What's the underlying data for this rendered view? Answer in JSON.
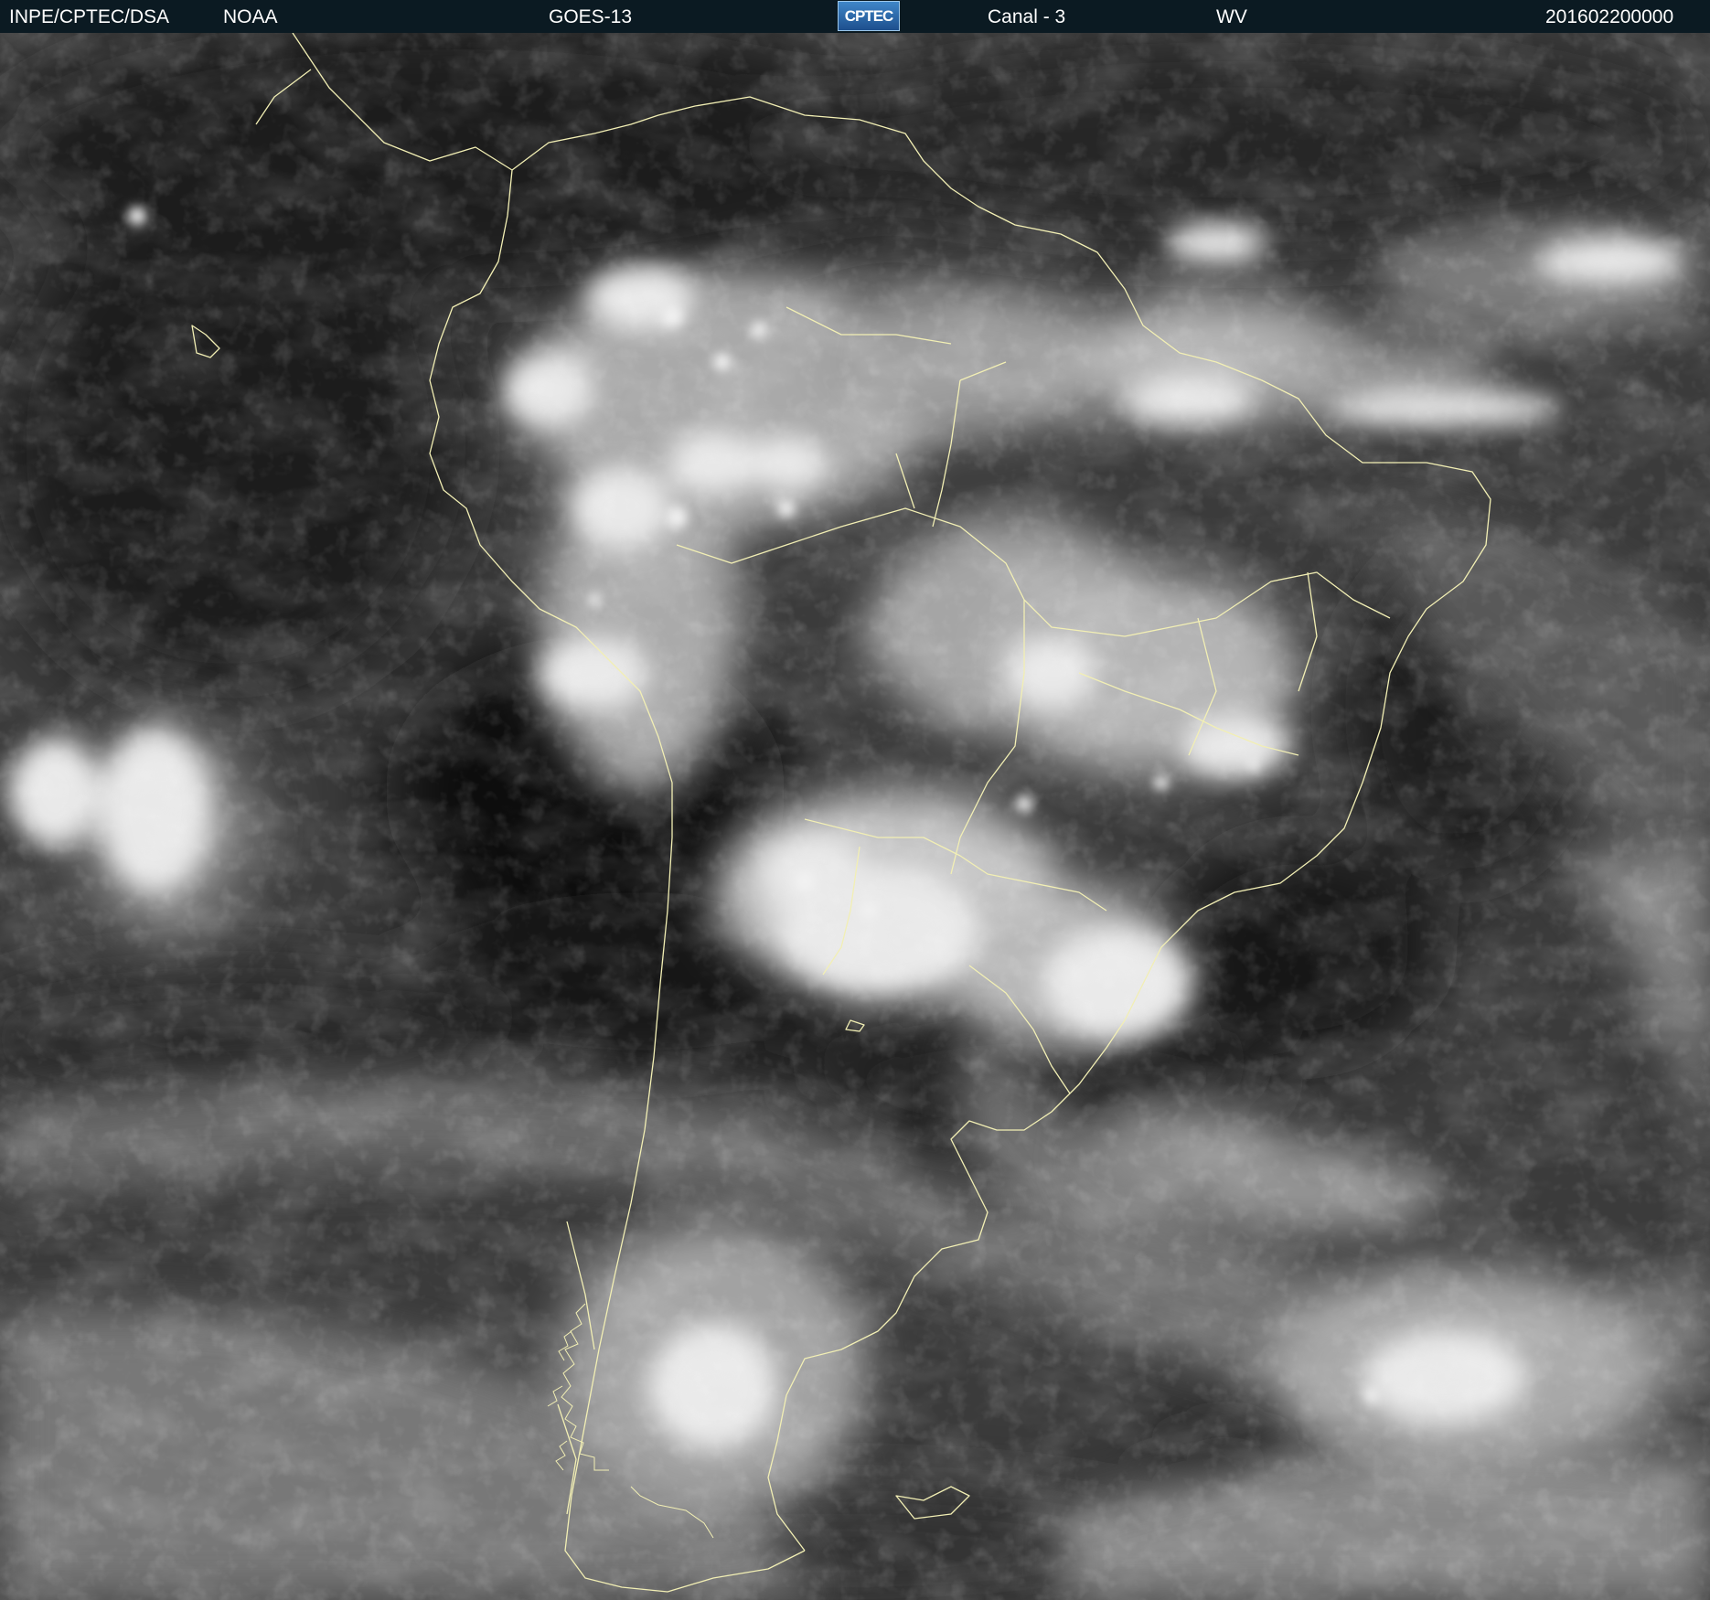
{
  "header": {
    "org": "INPE/CPTEC/DSA",
    "agency": "NOAA",
    "satellite": "GOES-13",
    "logo_text": "CPTEC",
    "channel": "Canal - 3",
    "band": "WV",
    "timestamp": "201602200000"
  },
  "colors": {
    "header_background": "#0b1a22",
    "header_text": "#ffffff",
    "coastline": "#f2efb4"
  },
  "image": {
    "type": "satellite-water-vapor-grayscale"
  }
}
